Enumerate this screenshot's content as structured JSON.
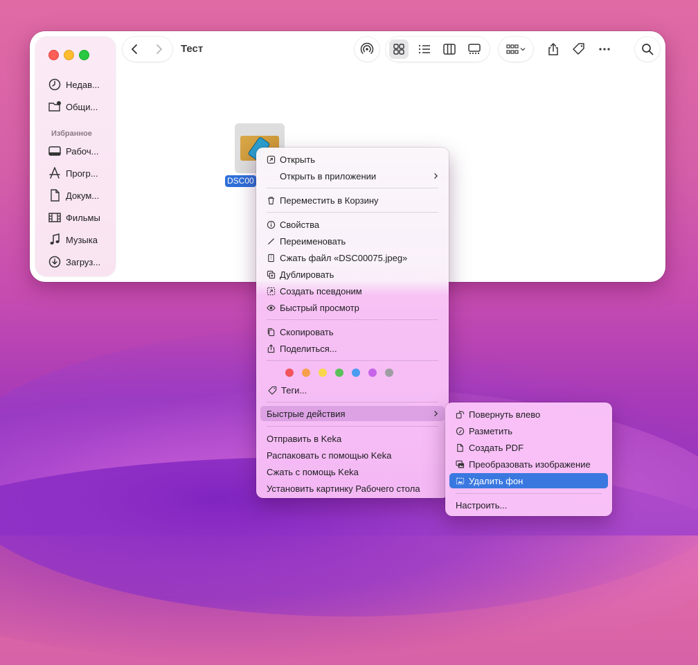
{
  "window": {
    "title": "Тест"
  },
  "sidebar": {
    "recents": [
      {
        "label": "Недав...",
        "icon": "clock-icon"
      },
      {
        "label": "Общи...",
        "icon": "shared-folder-icon"
      }
    ],
    "favorites_header": "Избранное",
    "favorites": [
      {
        "label": "Рабоч...",
        "icon": "desktop-icon"
      },
      {
        "label": "Прогр...",
        "icon": "applications-icon"
      },
      {
        "label": "Докум...",
        "icon": "document-icon"
      },
      {
        "label": "Фильмы",
        "icon": "film-icon"
      },
      {
        "label": "Музыка",
        "icon": "music-icon"
      },
      {
        "label": "Загруз...",
        "icon": "download-icon"
      }
    ]
  },
  "file": {
    "label": "DSC00"
  },
  "context_menu": {
    "open": "Открыть",
    "open_with": "Открыть в приложении",
    "move_to_trash": "Переместить в Корзину",
    "get_info": "Свойства",
    "rename": "Переименовать",
    "compress": "Сжать файл «DSC00075.jpeg»",
    "duplicate": "Дублировать",
    "make_alias": "Создать псевдоним",
    "quick_look": "Быстрый просмотр",
    "copy": "Скопировать",
    "share": "Поделиться...",
    "tags": "Теги...",
    "quick_actions": "Быстрые действия",
    "keka_send": "Отправить в Keka",
    "keka_extract": "Распаковать с помощью Keka",
    "keka_compress": "Сжать с помощь Keka",
    "set_desktop": "Установить картинку Рабочего стола",
    "tag_colors": [
      "#f2545b",
      "#f6a04d",
      "#f8d74a",
      "#5ac05a",
      "#4a9cf0",
      "#c663e8",
      "#9e9ea2"
    ]
  },
  "quick_actions_menu": {
    "rotate_left": "Повернуть влево",
    "markup": "Разметить",
    "create_pdf": "Создать PDF",
    "convert_image": "Преобразовать изображение",
    "remove_background": "Удалить фон",
    "customize": "Настроить..."
  },
  "colors": {
    "selection": "#3a78e0",
    "file_label_bg": "#2f6fd8"
  }
}
